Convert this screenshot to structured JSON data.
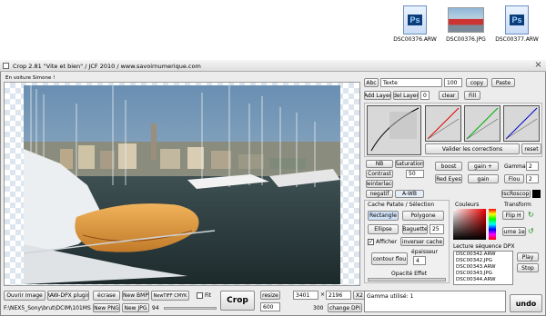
{
  "desktop": {
    "files": [
      {
        "name": "DSC00376.ARW",
        "type": "ps"
      },
      {
        "name": "DSC00376.JPG",
        "type": "jpg"
      },
      {
        "name": "DSC00377.ARW",
        "type": "ps"
      }
    ],
    "ps_label": "Ps"
  },
  "window": {
    "title": "Crop 2.81  \"Vite et bien\" / JCF 2010 / www.savoirnumerique.com",
    "close_glyph": "×",
    "status_top": "En voiture Simone !"
  },
  "text_row": {
    "abc": "Abc",
    "text_value": "Texte",
    "size": "100",
    "copy": "copy",
    "paste": "Paste"
  },
  "layer_row": {
    "add_layer": "Add Layer",
    "del_layer": "del Layer",
    "layer_index": "0",
    "clear": "clear",
    "fill": "Fill"
  },
  "curves": {
    "validate": "Valider les corrections",
    "reset": "reset"
  },
  "adjust": {
    "nb": "NB",
    "saturation": "Saturation",
    "contrast": "Contrast",
    "saturation_value": "50",
    "deinterlace": "deinterlace",
    "negatif": "negatif",
    "awb": "A-WB",
    "boost": "boost",
    "gain_plus": "gain +",
    "gamma": "Gamma",
    "gamma_value": "2",
    "red_eyes": "Red Eyes",
    "gain": "gain",
    "flou": "Flou",
    "flou_value": "2",
    "oscillo": "OscRoscope"
  },
  "cache": {
    "title": "Cache Patate / Sélection",
    "rectangle": "Rectangle",
    "polygone": "Polygone",
    "ellipse": "Ellipse",
    "baguette": "Baguette",
    "baguette_value": "25",
    "afficher": "Afficher",
    "inverser": "inverser cache",
    "epaisseur": "épaisseur",
    "contour": "contour flou",
    "contour_value": "4",
    "opacite": "Opacité Effet"
  },
  "couleurs": {
    "title": "Couleurs"
  },
  "transform": {
    "title": "Transform",
    "flip": "Flip H",
    "tourne": "tourne 1e/4"
  },
  "sequence": {
    "title": "Lecture séquence DPX",
    "files": [
      "DSC00342.ARW",
      "DSC00342.JPG",
      "DSC00343.ARW",
      "DSC00343.JPG",
      "DSC00344.ARW"
    ],
    "play": "Play",
    "stop": "Stop"
  },
  "bottom": {
    "ouvrir": "Ouvrir Image",
    "raw": "RAW-DPX plugin",
    "ecrase": "écrase",
    "new_bmp": "New BMP",
    "new_tiff": "NewTIFF CMYK",
    "fit": "Fit",
    "crop": "Crop",
    "resize": "resize",
    "width": "3401",
    "times": "×",
    "height": "2196",
    "x2": "X2",
    "path": "F:\\NEX5_Sony\\brut\\DCIM\\101MSD!",
    "new_png": "New PNG",
    "new_jpg": "New JPG",
    "jpg_quality": "94",
    "resize_value": "600",
    "dpi_value": "300",
    "change_dpi": "change DPI",
    "gamma_status": "Gamma utilisé: 1",
    "undo": "undo"
  }
}
